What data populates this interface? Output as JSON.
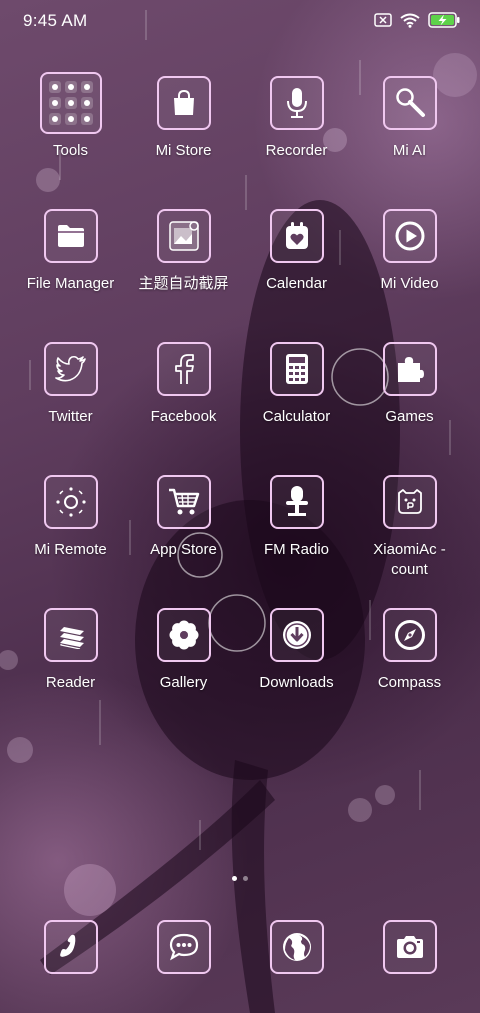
{
  "status_bar": {
    "time": "9:45 AM",
    "icons": [
      "sim-off-icon",
      "wifi-icon",
      "battery-charging-icon"
    ],
    "battery_color": "#5ed24a"
  },
  "apps": [
    {
      "label": "Tools",
      "icon": "tools-folder-icon"
    },
    {
      "label": "Mi Store",
      "icon": "shopping-bag-icon"
    },
    {
      "label": "Recorder",
      "icon": "microphone-icon"
    },
    {
      "label": "Mi AI",
      "icon": "mi-ai-microphone-icon"
    },
    {
      "label": "File Manager",
      "icon": "folder-icon"
    },
    {
      "label": "主题自动截屏",
      "icon": "screenshot-icon"
    },
    {
      "label": "Calendar",
      "icon": "calendar-icon"
    },
    {
      "label": "Mi Video",
      "icon": "play-icon"
    },
    {
      "label": "Twitter",
      "icon": "twitter-bird-icon"
    },
    {
      "label": "Facebook",
      "icon": "facebook-icon"
    },
    {
      "label": "Calculator",
      "icon": "calculator-icon"
    },
    {
      "label": "Games",
      "icon": "puzzle-icon"
    },
    {
      "label": "Mi Remote",
      "icon": "remote-icon"
    },
    {
      "label": "App Store",
      "icon": "cart-icon"
    },
    {
      "label": "FM Radio",
      "icon": "radio-microphone-icon"
    },
    {
      "label": "XiaomiAc - count",
      "icon": "account-badge-icon"
    },
    {
      "label": "Reader",
      "icon": "books-icon"
    },
    {
      "label": "Gallery",
      "icon": "flower-icon"
    },
    {
      "label": "Downloads",
      "icon": "download-icon"
    },
    {
      "label": "Compass",
      "icon": "compass-icon"
    }
  ],
  "dock": [
    {
      "icon": "phone-icon"
    },
    {
      "icon": "messages-icon"
    },
    {
      "icon": "browser-globe-icon"
    },
    {
      "icon": "camera-icon"
    }
  ],
  "page_indicator": {
    "pages": 2,
    "current": 1
  },
  "colors": {
    "tile_border": "#f0c8f0",
    "wallpaper": "#5f3d5e"
  }
}
